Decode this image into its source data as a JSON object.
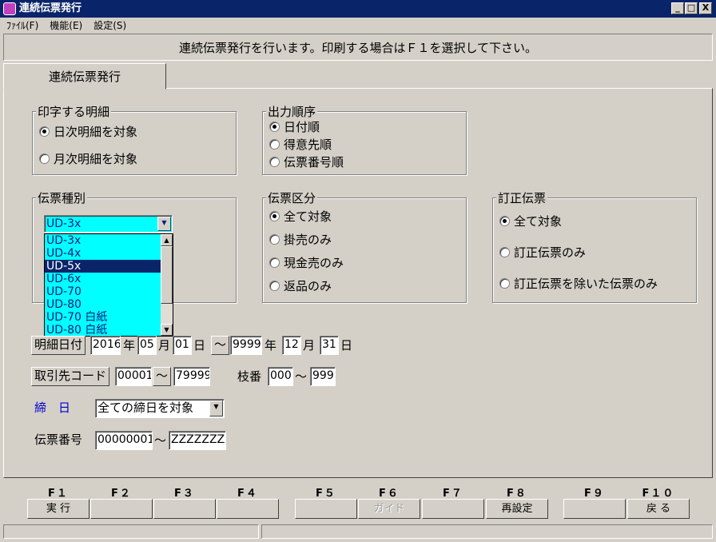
{
  "window": {
    "title": "連続伝票発行",
    "min": "_",
    "max": "□",
    "close": "X"
  },
  "menu": [
    "ﾌｧｲﾙ(F)",
    "機能(E)",
    "設定(S)"
  ],
  "message": "連続伝票発行を行います。印刷する場合はＦ１を選択して下さい。",
  "tab": "連続伝票発行",
  "print_detail": {
    "legend": "印字する明細",
    "options": [
      "日次明細を対象",
      "月次明細を対象"
    ],
    "selected": 0
  },
  "output_order": {
    "legend": "出力順序",
    "options": [
      "日付順",
      "得意先順",
      "伝票番号順"
    ],
    "selected": 0
  },
  "slip_type": {
    "legend": "伝票種別",
    "value": "UD-3x",
    "items": [
      "UD-3x",
      "UD-4x",
      "UD-5x",
      "UD-6x",
      "UD-70",
      "UD-80",
      "UD-70 白紙",
      "UD-80 白紙"
    ],
    "selected": 2
  },
  "slip_class": {
    "legend": "伝票区分",
    "options": [
      "全て対象",
      "掛売のみ",
      "現金売のみ",
      "返品のみ"
    ],
    "selected": 0
  },
  "correction": {
    "legend": "訂正伝票",
    "options": [
      "全て対象",
      "訂正伝票のみ",
      "訂正伝票を除いた伝票のみ"
    ],
    "selected": 0
  },
  "date_range": {
    "label": "明細日付",
    "from_year": "2016",
    "from_month": "05",
    "from_day": "01",
    "to_year": "9999",
    "to_month": "12",
    "to_day": "31",
    "year": "年",
    "month": "月",
    "day": "日",
    "tilde": "～"
  },
  "customer": {
    "label": "取引先コード",
    "from": "00001",
    "tilde": "～",
    "to": "79999",
    "branch_label": "枝番",
    "branch_from": "000",
    "branch_to": "999"
  },
  "closing": {
    "label": "締　日",
    "value": "全ての締日を対象",
    "color": "#0000cc"
  },
  "slip_no": {
    "label": "伝票番号",
    "from": "00000001",
    "tilde": "～",
    "to": "ZZZZZZZZ"
  },
  "fkeys": [
    {
      "key": "F１",
      "label": "実 行",
      "enabled": true
    },
    {
      "key": "F２",
      "label": "",
      "enabled": true
    },
    {
      "key": "F３",
      "label": "",
      "enabled": true
    },
    {
      "key": "F４",
      "label": "",
      "enabled": true
    },
    {
      "key": "F５",
      "label": "",
      "enabled": true
    },
    {
      "key": "F６",
      "label": "ガイド",
      "enabled": false
    },
    {
      "key": "F７",
      "label": "",
      "enabled": true
    },
    {
      "key": "F８",
      "label": "再設定",
      "enabled": true
    },
    {
      "key": "F９",
      "label": "",
      "enabled": true
    },
    {
      "key": "F１０",
      "label": "戻 る",
      "enabled": true
    }
  ]
}
